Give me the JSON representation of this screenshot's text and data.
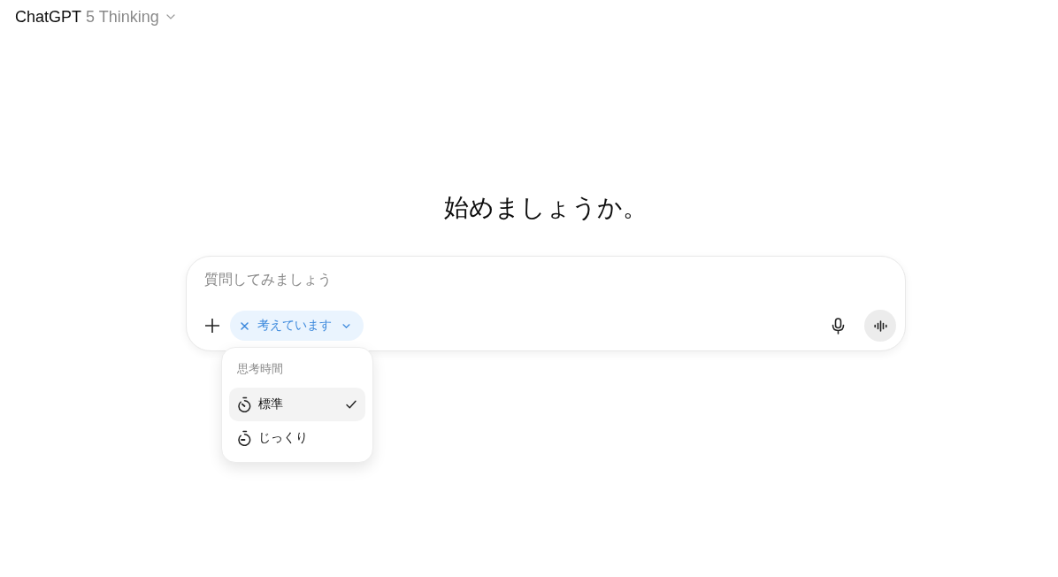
{
  "header": {
    "title": "ChatGPT",
    "model": "5 Thinking"
  },
  "heading": "始めましょうか。",
  "composer": {
    "placeholder": "質問してみましょう",
    "tool_chip": {
      "label": "考えています",
      "expanded": true
    }
  },
  "thinking_menu": {
    "title": "思考時間",
    "options": [
      {
        "label": "標準",
        "selected": true
      },
      {
        "label": "じっくり",
        "selected": false
      }
    ]
  }
}
